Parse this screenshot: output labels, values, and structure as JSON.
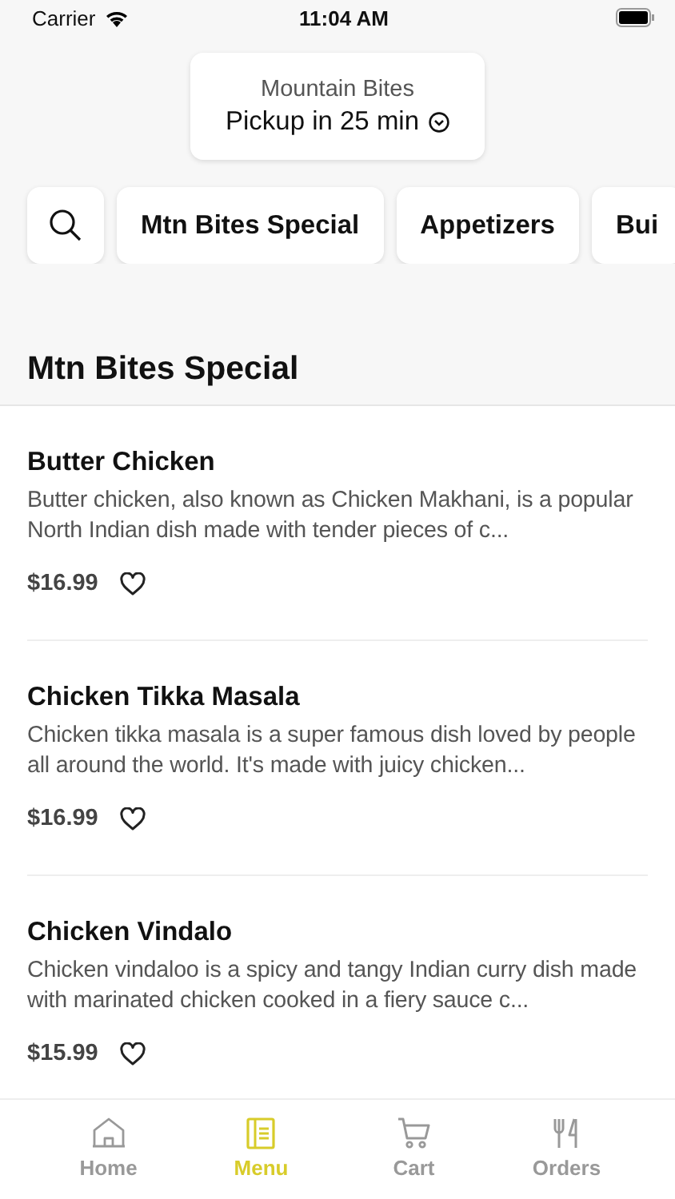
{
  "status_bar": {
    "carrier": "Carrier",
    "time": "11:04 AM"
  },
  "header": {
    "restaurant": "Mountain Bites",
    "pickup": "Pickup in 25 min"
  },
  "categories": [
    "Mtn Bites Special",
    "Appetizers",
    "Bui"
  ],
  "section_title": "Mtn Bites Special",
  "items": [
    {
      "name": "Butter Chicken",
      "description": "Butter chicken, also known as Chicken Makhani, is a popular North Indian dish made with tender pieces of c...",
      "price": "$16.99"
    },
    {
      "name": "Chicken Tikka Masala",
      "description": "Chicken tikka masala is a super famous dish loved by people all around the world. It's made with juicy chicken...",
      "price": "$16.99"
    },
    {
      "name": "Chicken Vindalo",
      "description": "Chicken vindaloo is a spicy and tangy Indian curry dish made with marinated chicken cooked in a fiery sauce c...",
      "price": "$15.99"
    }
  ],
  "tab_bar": [
    {
      "label": "Home",
      "kind": "home",
      "selected": false
    },
    {
      "label": "Menu",
      "kind": "menu",
      "selected": true
    },
    {
      "label": "Cart",
      "kind": "cart",
      "selected": false
    },
    {
      "label": "Orders",
      "kind": "orders",
      "selected": false
    }
  ]
}
